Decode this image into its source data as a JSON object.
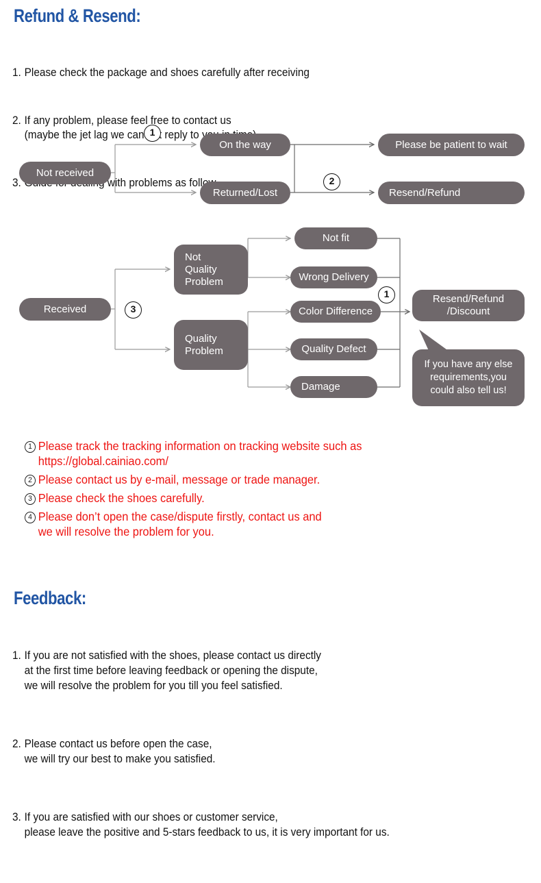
{
  "colors": {
    "heading_blue": "#2155a4",
    "node_gray": "#6f686b",
    "line_gray": "#9a9a9a",
    "red": "#ee1412",
    "text_black": "#111111"
  },
  "refund_section": {
    "heading": "Refund & Resend:",
    "items": [
      {
        "num": "1.",
        "text": "Please check the package and shoes carefully after receiving"
      },
      {
        "num": "2.",
        "text": "If any problem, please feel free to contact us\n(maybe the jet lag we can not reply to you in time)"
      },
      {
        "num": "3.",
        "text": "Guide for dealing with problems as follow"
      }
    ]
  },
  "flowchart_not_received": {
    "source": "Not received",
    "middle": [
      "On the way",
      "Returned/Lost"
    ],
    "results": [
      "Please be patient to wait",
      "Resend/Refund"
    ],
    "markers": [
      "1",
      "2"
    ]
  },
  "flowchart_received": {
    "source": "Received",
    "marker_left": "3",
    "categories": [
      "Not\nQuality\nProblem",
      "Quality\nProblem"
    ],
    "not_quality_reasons": [
      "Not fit",
      "Wrong Delivery"
    ],
    "quality_reasons": [
      "Color Difference",
      "Quality Defect",
      "Damage"
    ],
    "marker_right": "1",
    "result": "Resend/Refund\n/Discount",
    "bubble": "If you have any else\nrequirements,you\ncould also tell us!"
  },
  "red_notes": [
    {
      "num": "1",
      "text": "Please track the tracking information on tracking website such as\nhttps://global.cainiao.com/"
    },
    {
      "num": "2",
      "text": "Please contact us by e-mail, message or trade manager."
    },
    {
      "num": "3",
      "text": "Please check the shoes carefully."
    },
    {
      "num": "4",
      "text": "Please don’t open the case/dispute firstly, contact us and\nwe will resolve the problem for you."
    }
  ],
  "feedback_section": {
    "heading": "Feedback:",
    "items": [
      {
        "num": "1.",
        "text": "If you are not satisfied with the shoes, please contact us directly\nat the first time before leaving feedback or opening the dispute,\nwe will resolve the problem for you till you feel satisfied."
      },
      {
        "num": "2.",
        "text": "Please contact us before open the case,\nwe will try our best to make you satisfied."
      },
      {
        "num": "3.",
        "text": "If you are satisfied with our shoes or customer service,\nplease leave the positive and 5-stars feedback to us, it is very important for us."
      }
    ]
  }
}
